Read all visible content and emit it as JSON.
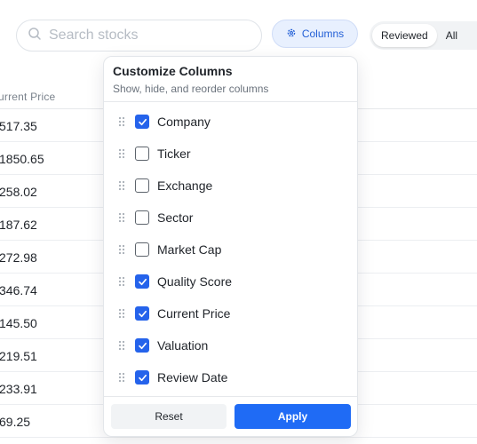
{
  "search": {
    "placeholder": "Search stocks",
    "icon": "search-icon"
  },
  "toolbar": {
    "columns_label": "Columns",
    "columns_icon": "gear-icon"
  },
  "filter_tabs": [
    {
      "label": "Reviewed",
      "active": true
    },
    {
      "label": "All",
      "active": false
    }
  ],
  "table": {
    "visible_header": "urrent Price",
    "prices": [
      "517.35",
      "1850.65",
      "258.02",
      "187.62",
      "272.98",
      "346.74",
      "145.50",
      "219.51",
      "233.91",
      "69.25"
    ]
  },
  "customize_panel": {
    "title": "Customize Columns",
    "subtitle": "Show, hide, and reorder columns",
    "columns": [
      {
        "label": "Company",
        "checked": true
      },
      {
        "label": "Ticker",
        "checked": false
      },
      {
        "label": "Exchange",
        "checked": false
      },
      {
        "label": "Sector",
        "checked": false
      },
      {
        "label": "Market Cap",
        "checked": false
      },
      {
        "label": "Quality Score",
        "checked": true
      },
      {
        "label": "Current Price",
        "checked": true
      },
      {
        "label": "Valuation",
        "checked": true
      },
      {
        "label": "Review Date",
        "checked": true
      }
    ],
    "reset_label": "Reset",
    "apply_label": "Apply"
  },
  "colors": {
    "accent": "#2563eb",
    "apply": "#1f6bf5",
    "columns_bg": "#e8f0fe",
    "columns_text": "#2460d6"
  }
}
